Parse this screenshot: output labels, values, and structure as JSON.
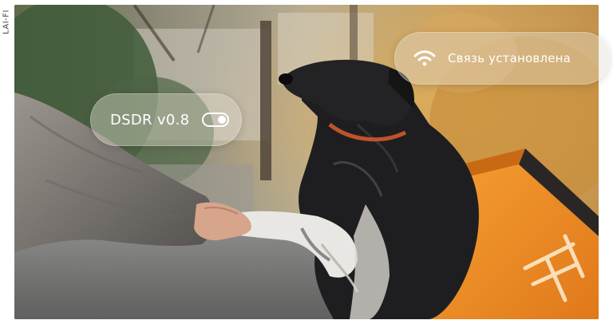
{
  "side_tag": {
    "text": "LAI-FI"
  },
  "overlay": {
    "app_pill": {
      "label": "DSDR v0.8",
      "toggle_state": "on",
      "icon": "toggle-icon"
    },
    "connection_pill": {
      "label": "Связь установлена",
      "icon": "wifi-icon"
    }
  },
  "colors": {
    "pill_glass": "#E1DCCD",
    "text": "#FFFFFF",
    "bag_orange": "#F08A1C",
    "dog_black": "#1E1E20",
    "sleeve_gray": "#7A7671"
  }
}
